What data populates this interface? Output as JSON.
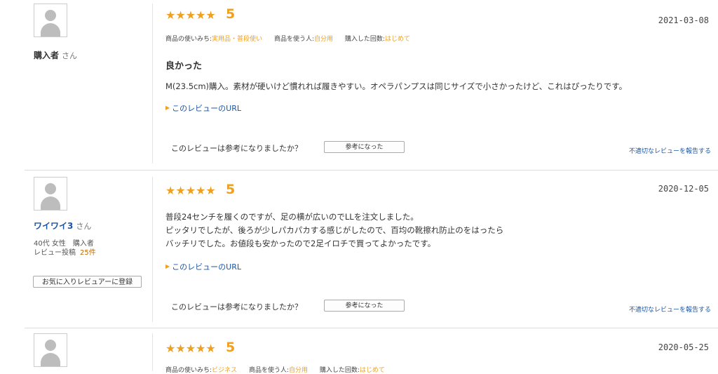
{
  "reviews": [
    {
      "reviewer_name": "購入者",
      "honorific": "さん",
      "rating_stars": "★★★★★",
      "rating": "5",
      "date": "2021-03-08",
      "usage_label": "商品の使いみち:",
      "usage_value": "実用品・普段使い",
      "user_label": "商品を使う人:",
      "user_value": "自分用",
      "count_label": "購入した回数:",
      "count_value": "はじめて",
      "title": "良かった",
      "body_lines": [
        "M(23.5cm)購入。素材が硬いけど慣れれば履きやすい。オペラパンプスは同じサイズで小さかったけど、これはぴったりです。"
      ],
      "url_link": "このレビューのURL",
      "helpful_question": "このレビューは参考になりましたか？",
      "helpful_button": "参考になった",
      "report_link": "不適切なレビューを報告する"
    },
    {
      "reviewer_name": "ワイワイ3",
      "honorific": "さん",
      "reviewer_profile": "40代 女性　購入者",
      "reviewer_post_label": "レビュー投稿",
      "reviewer_post_count": "25件",
      "fav_button": "お気に入りレビュアーに登録",
      "rating_stars": "★★★★★",
      "rating": "5",
      "date": "2020-12-05",
      "body_lines": [
        "普段24センチを履くのですが、足の横が広いのでLLを注文しました。",
        "ピッタリでしたが、後ろが少しパカパカする感じがしたので、百均の靴擦れ防止のをはったら",
        "バッチリでした。お値段も安かったので2足イロチで買ってよかったです。"
      ],
      "url_link": "このレビューのURL",
      "helpful_question": "このレビューは参考になりましたか？",
      "helpful_button": "参考になった",
      "report_link": "不適切なレビューを報告する"
    },
    {
      "rating_stars": "★★★★★",
      "rating": "5",
      "date": "2020-05-25",
      "usage_label": "商品の使いみち:",
      "usage_value": "ビジネス",
      "user_label": "商品を使う人:",
      "user_value": "自分用",
      "count_label": "購入した回数:",
      "count_value": "はじめて"
    }
  ]
}
